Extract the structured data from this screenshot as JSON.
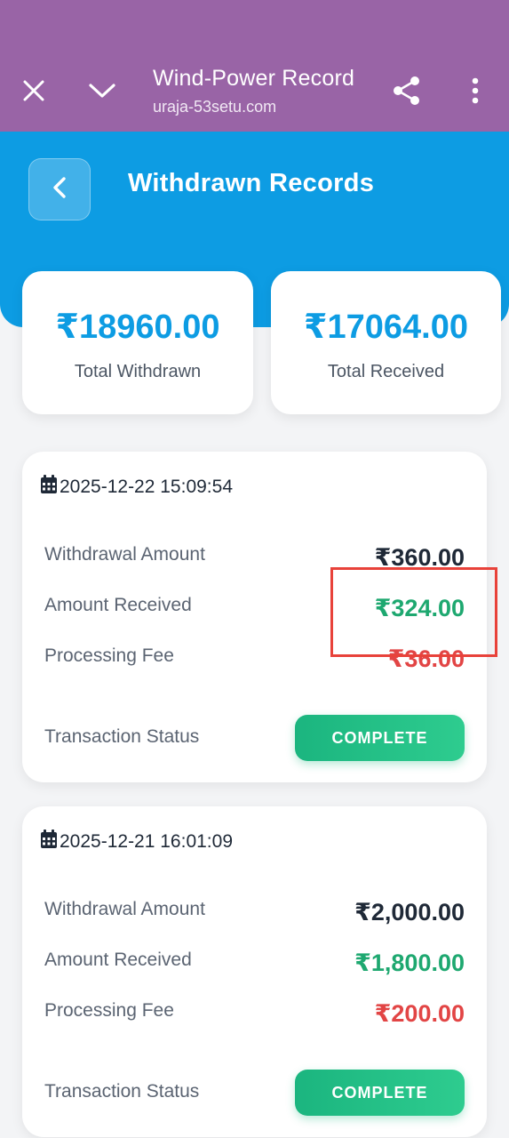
{
  "browser": {
    "title": "Wind-Power Record",
    "url": "uraja-53setu.com",
    "icons": [
      "close-icon",
      "chevron-down-icon",
      "share-icon",
      "more-vert-icon"
    ]
  },
  "page": {
    "title": "Withdrawn Records",
    "back_icon": "chevron-left-icon"
  },
  "summary": {
    "total_withdrawn_value": "₹18960.00",
    "total_withdrawn_label": "Total Withdrawn",
    "total_received_value": "₹17064.00",
    "total_received_label": "Total Received"
  },
  "records": [
    {
      "date": "2025-12-22 15:09:54",
      "withdrawal_label": "Withdrawal Amount",
      "withdrawal_value": "₹360.00",
      "received_label": "Amount Received",
      "received_value": "₹324.00",
      "fee_label": "Processing Fee",
      "fee_value": "₹36.00",
      "status_label": "Transaction Status",
      "status_value": "COMPLETE"
    },
    {
      "date": "2025-12-21 16:01:09",
      "withdrawal_label": "Withdrawal Amount",
      "withdrawal_value": "₹2,000.00",
      "received_label": "Amount Received",
      "received_value": "₹1,800.00",
      "fee_label": "Processing Fee",
      "fee_value": "₹200.00",
      "status_label": "Transaction Status",
      "status_value": "COMPLETE"
    }
  ],
  "colors": {
    "browser_bar": "#9964a6",
    "header": "#0d9ce3",
    "received": "#1ea870",
    "fee": "#e24545",
    "status": "#1bb57f",
    "annotation": "#e8423a"
  }
}
